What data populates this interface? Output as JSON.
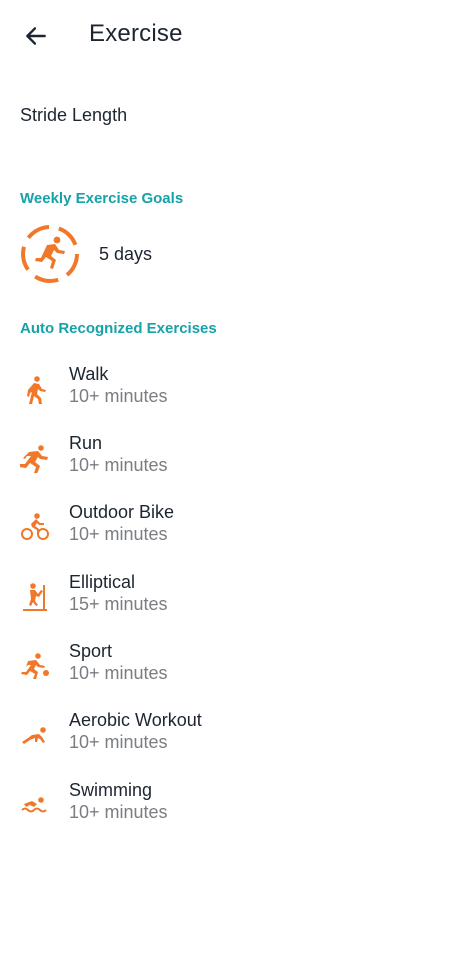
{
  "header": {
    "title": "Exercise"
  },
  "stride": {
    "label": "Stride Length"
  },
  "weekly": {
    "section_title": "Weekly Exercise Goals",
    "value": "5 days"
  },
  "auto": {
    "section_title": "Auto Recognized Exercises"
  },
  "exercises": [
    {
      "name": "Walk",
      "duration": "10+ minutes",
      "icon": "walk-icon"
    },
    {
      "name": "Run",
      "duration": "10+ minutes",
      "icon": "run-icon"
    },
    {
      "name": "Outdoor Bike",
      "duration": "10+ minutes",
      "icon": "bike-icon"
    },
    {
      "name": "Elliptical",
      "duration": "15+ minutes",
      "icon": "elliptical-icon"
    },
    {
      "name": "Sport",
      "duration": "10+ minutes",
      "icon": "sport-icon"
    },
    {
      "name": "Aerobic Workout",
      "duration": "10+ minutes",
      "icon": "aerobic-icon"
    },
    {
      "name": "Swimming",
      "duration": "10+ minutes",
      "icon": "swim-icon"
    }
  ],
  "colors": {
    "accent": "#16a2a9",
    "icon_orange": "#f0782a",
    "text_primary": "#1d2530",
    "text_secondary": "#7a7d82"
  }
}
